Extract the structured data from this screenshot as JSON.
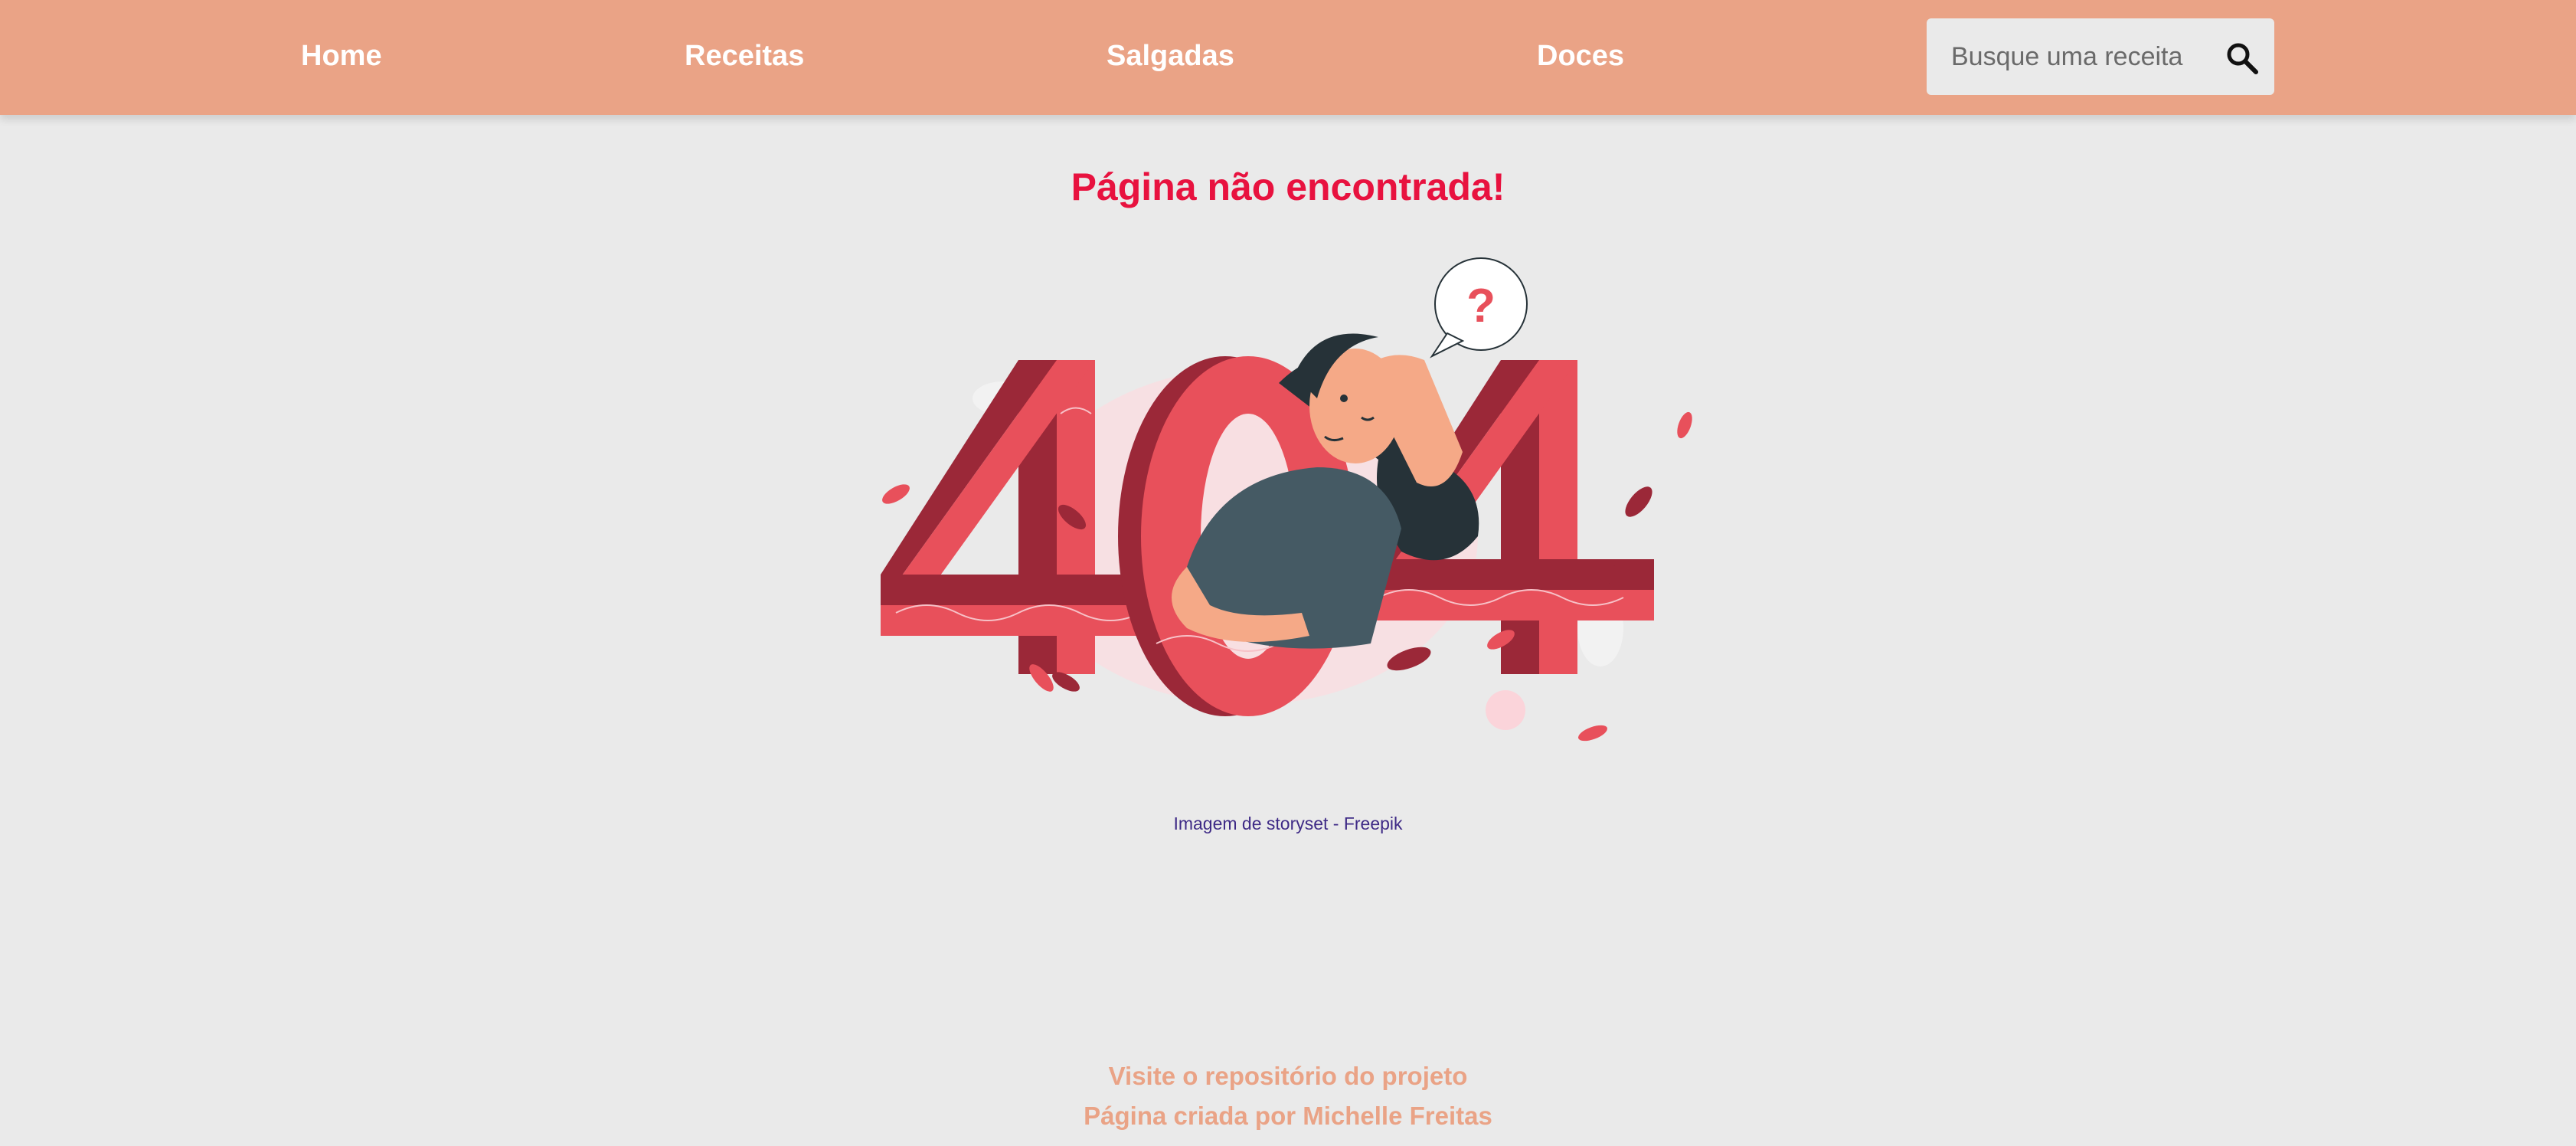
{
  "nav": {
    "items": [
      {
        "label": "Home"
      },
      {
        "label": "Receitas"
      },
      {
        "label": "Salgadas"
      },
      {
        "label": "Doces"
      }
    ],
    "search": {
      "placeholder": "Busque uma receita",
      "value": "",
      "icon": "search-icon"
    }
  },
  "main": {
    "title": "Página não encontrada!",
    "illustration_text": "404",
    "bubble_text": "?",
    "credit": "Imagem de storyset - Freepik"
  },
  "footer": {
    "repo_link": "Visite o repositório do projeto",
    "author_link": "Página criada por Michelle Freitas"
  },
  "colors": {
    "navbar": "#eaa386",
    "background": "#eaeaea",
    "title": "#e8123f",
    "accent_red": "#e8505b",
    "dark_red": "#9b2838",
    "footer_text": "#eaa386",
    "credit_link": "#3e2a86"
  }
}
